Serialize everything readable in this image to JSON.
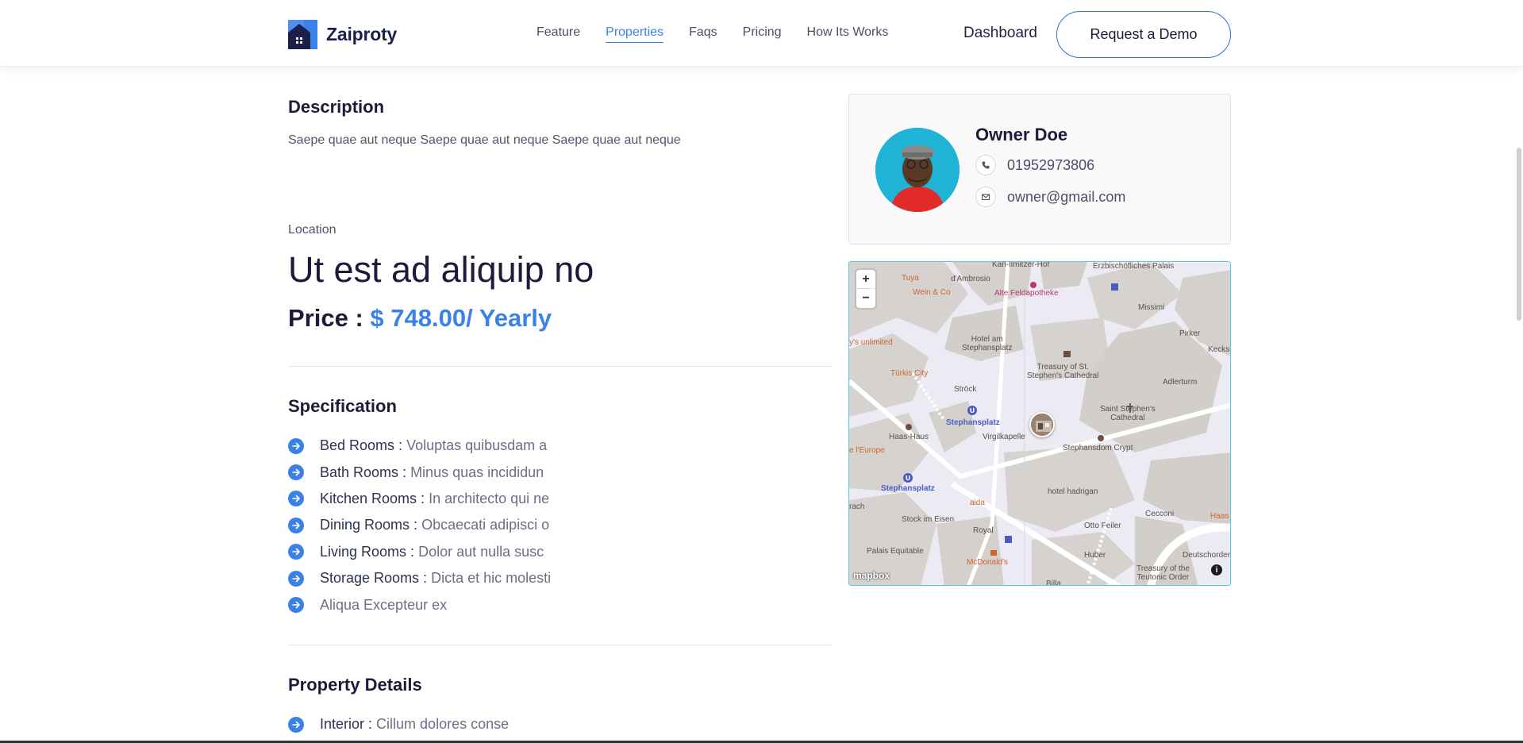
{
  "brand": {
    "name": "Zaiproty",
    "accent": "#3b82e8"
  },
  "nav": {
    "items": [
      {
        "label": "Feature",
        "active": false
      },
      {
        "label": "Properties",
        "active": true
      },
      {
        "label": "Faqs",
        "active": false
      },
      {
        "label": "Pricing",
        "active": false
      },
      {
        "label": "How Its Works",
        "active": false
      }
    ],
    "dashboard": "Dashboard",
    "demo_button": "Request a Demo"
  },
  "description": {
    "heading": "Description",
    "text": "Saepe quae aut neque Saepe quae aut neque Saepe quae aut neque"
  },
  "listing": {
    "location_label": "Location",
    "title": "Ut est ad aliquip no",
    "price_label": "Price :",
    "price_value": "$ 748.00/ Yearly"
  },
  "specification": {
    "heading": "Specification",
    "items": [
      {
        "key": "Bed Rooms :",
        "value": "Voluptas quibusdam a"
      },
      {
        "key": "Bath Rooms :",
        "value": "Minus quas incididun"
      },
      {
        "key": "Kitchen Rooms :",
        "value": "In architecto qui ne"
      },
      {
        "key": "Dining Rooms :",
        "value": "Obcaecati adipisci o"
      },
      {
        "key": "Living Rooms :",
        "value": "Dolor aut nulla susc"
      },
      {
        "key": "Storage Rooms :",
        "value": "Dicta et hic molesti"
      },
      {
        "key": "",
        "value": "Aliqua Excepteur ex"
      }
    ]
  },
  "property_details": {
    "heading": "Property Details",
    "items": [
      {
        "key": "Interior :",
        "value": "Cillum dolores conse"
      }
    ]
  },
  "owner": {
    "name": "Owner Doe",
    "phone": "01952973806",
    "email": "owner@gmail.com"
  },
  "map": {
    "zoom_in": "+",
    "zoom_out": "−",
    "attribution": "mapbox",
    "info": "i",
    "labels": {
      "karl": "Karl-Ilmitzer-Hof",
      "erz": "Erzbischöfliches Palais",
      "tuya": "Tuya",
      "ambrosio": "d'Ambrosio",
      "wein": "Wein & Co",
      "alte": "Alte Feldapotheke",
      "missimi": "Missimi",
      "pirker": "Pirker",
      "kecksil": "Kecksil",
      "unlimited": "y's unlimited",
      "hotel_am": "Hotel am\nStephansplatz",
      "treasury": "Treasury of St.\nStephen's Cathedral",
      "adlerturm": "Adlerturm",
      "turkis": "Türkis City",
      "stroeck": "Ströck",
      "saint": "Saint Stephen's\nCathedral",
      "stephansplatz1": "Stephansplatz",
      "haas_haus": "Haas-Haus",
      "virgil": "Virgilkapelle",
      "crypt": "Stephansdom Crypt",
      "europe": "e l'Europe",
      "stephansplatz2": "Stephansplatz",
      "hotel_hadrigan": "hotel hadrigan",
      "aida": "aida",
      "rach": "rach",
      "stock": "Stock im Eisen",
      "royal": "Royal",
      "cecconi": "Cecconi",
      "haas": "Haas",
      "otto": "Otto Feiler",
      "palais": "Palais Equitable",
      "mcd": "McDonald's",
      "huber": "Huber",
      "deutsch": "Deutschordensha",
      "treasury_to": "Treasury of the\nTeutonic Order",
      "billa": "Billa"
    }
  }
}
